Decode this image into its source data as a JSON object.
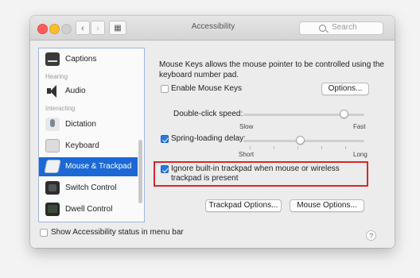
{
  "window": {
    "title": "Accessibility",
    "search_placeholder": "Search",
    "nav_back": "‹",
    "nav_forward": "›",
    "nav_grid": "▦"
  },
  "sidebar": {
    "items": [
      {
        "label": "Captions",
        "icon": "captions-icon"
      },
      {
        "section": "Hearing"
      },
      {
        "label": "Audio",
        "icon": "speaker-icon"
      },
      {
        "section": "Interacting"
      },
      {
        "label": "Dictation",
        "icon": "microphone-icon"
      },
      {
        "label": "Keyboard",
        "icon": "keyboard-icon"
      },
      {
        "label": "Mouse & Trackpad",
        "icon": "trackpad-icon",
        "selected": true
      },
      {
        "label": "Switch Control",
        "icon": "switch-control-icon"
      },
      {
        "label": "Dwell Control",
        "icon": "dwell-control-icon"
      }
    ]
  },
  "main": {
    "description": "Mouse Keys allows the mouse pointer to be controlled using the keyboard number pad.",
    "enable_mouse_keys": {
      "label": "Enable Mouse Keys",
      "checked": false
    },
    "options_button": "Options...",
    "double_click": {
      "label": "Double-click speed:",
      "min_label": "Slow",
      "max_label": "Fast",
      "value": 0.83
    },
    "spring_loading": {
      "label": "Spring-loading delay:",
      "checked": true,
      "min_label": "Short",
      "max_label": "Long",
      "value": 0.47
    },
    "ignore_trackpad": {
      "label": "Ignore built-in trackpad when mouse or wireless trackpad is present",
      "checked": true
    },
    "trackpad_options_button": "Trackpad Options...",
    "mouse_options_button": "Mouse Options..."
  },
  "footer": {
    "show_status_label": "Show Accessibility status in menu bar",
    "show_status_checked": false,
    "help": "?"
  },
  "colors": {
    "accent": "#1b68d6",
    "highlight_border": "#d6282c"
  }
}
